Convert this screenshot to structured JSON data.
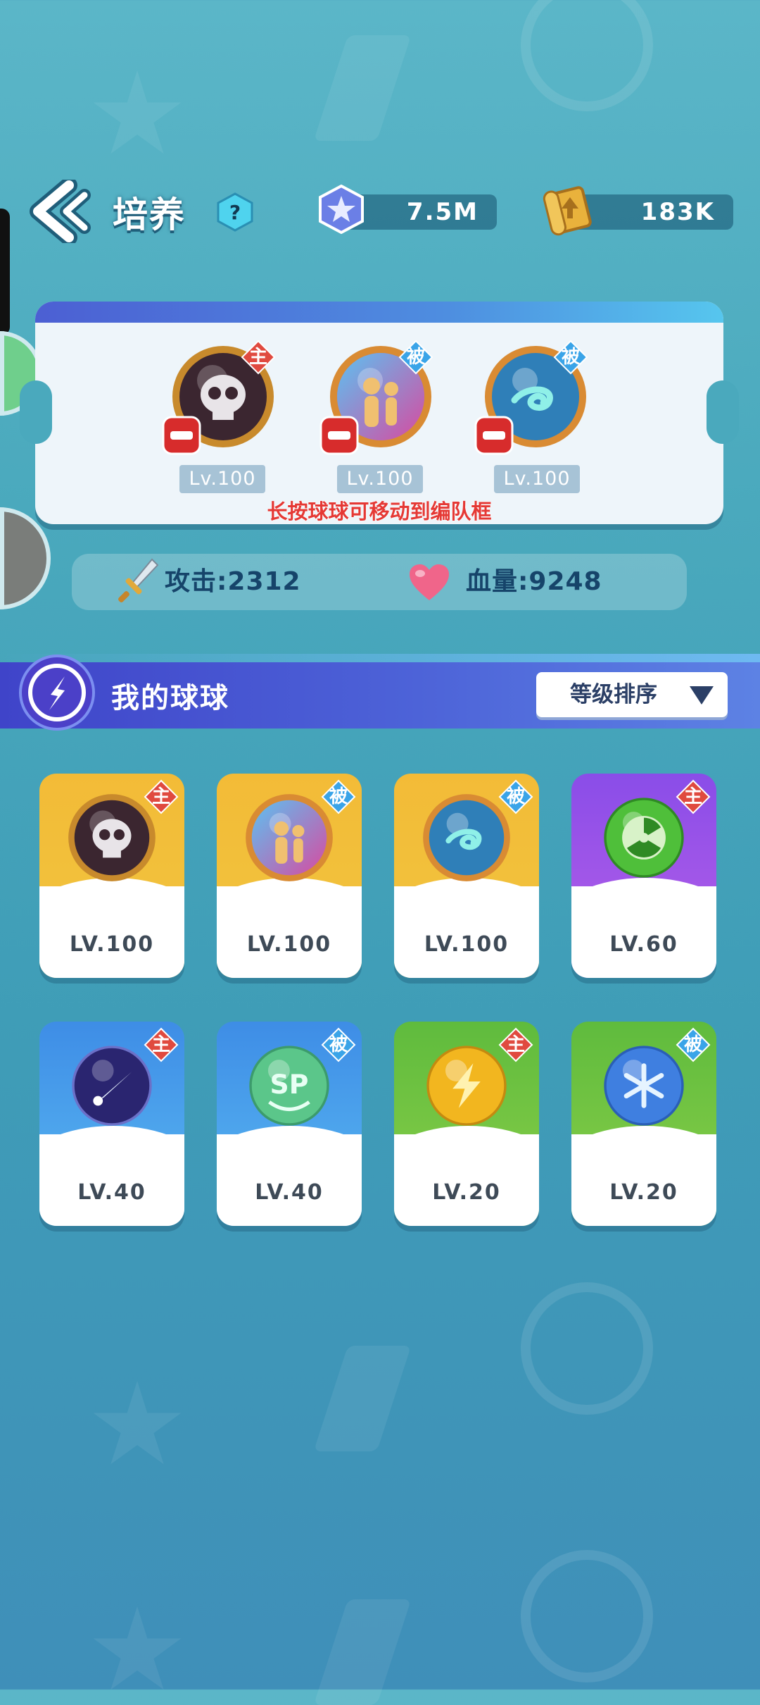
{
  "header": {
    "title": "培养",
    "help_label": "?",
    "gems_value": "7.5M",
    "scrolls_value": "183K"
  },
  "team": {
    "slots": [
      {
        "badge": "主",
        "level": "Lv.100",
        "icon": "skull-ball-icon"
      },
      {
        "badge": "被",
        "level": "Lv.100",
        "icon": "crowd-ball-icon"
      },
      {
        "badge": "被",
        "level": "Lv.100",
        "icon": "swirl-ball-icon"
      }
    ],
    "hint": "长按球球可移动到编队框"
  },
  "stats": {
    "attack": "攻击:2312",
    "hp": "血量:9248"
  },
  "my_balls": {
    "title": "我的球球",
    "sort_label": "等级排序",
    "cards": [
      {
        "badge": "主",
        "level": "LV.100",
        "icon": "skull-ball-icon",
        "color": "#f2c03d"
      },
      {
        "badge": "被",
        "level": "LV.100",
        "icon": "crowd-ball-icon",
        "color": "#f2c03d"
      },
      {
        "badge": "被",
        "level": "LV.100",
        "icon": "swirl-ball-icon",
        "color": "#f2c03d"
      },
      {
        "badge": "主",
        "level": "LV.60",
        "icon": "radiation-ball-icon",
        "color": "#a457e9"
      },
      {
        "badge": "主",
        "level": "LV.40",
        "icon": "meteor-ball-icon",
        "color": "#4aa2ec"
      },
      {
        "badge": "被",
        "level": "LV.40",
        "icon": "sp-ball-icon",
        "color": "#4aa2ec"
      },
      {
        "badge": "主",
        "level": "LV.20",
        "icon": "lightning-ball-icon",
        "color": "#76c545"
      },
      {
        "badge": "被",
        "level": "LV.20",
        "icon": "snowflake-ball-icon",
        "color": "#76c545"
      }
    ]
  },
  "colors": {
    "main_badge": "#e04a3f",
    "passive_badge": "#3aa4e8"
  }
}
